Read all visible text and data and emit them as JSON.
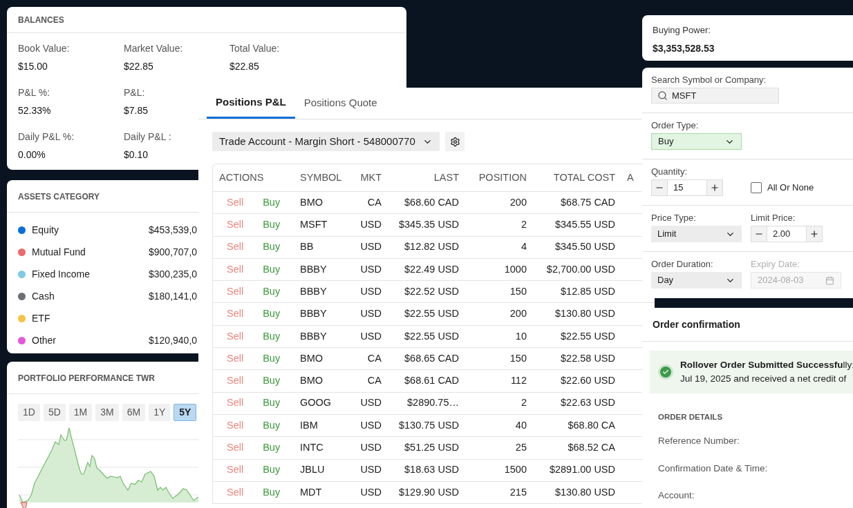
{
  "balances": {
    "title": "BALANCES",
    "rows": [
      [
        {
          "label": "Book Value:",
          "value": "$15.00"
        },
        {
          "label": "Market Value:",
          "value": "$22.85"
        },
        {
          "label": "Total Value:",
          "value": "$22.85"
        }
      ],
      [
        {
          "label": "P&L %:",
          "value": "52.33%"
        },
        {
          "label": "P&L:",
          "value": "$7.85"
        }
      ],
      [
        {
          "label": "Daily P&L %:",
          "value": "0.00%"
        },
        {
          "label": "Daily P&L :",
          "value": "$0.10"
        }
      ]
    ]
  },
  "assets": {
    "title": "ASSETS CATEGORY",
    "items": [
      {
        "label": "Equity",
        "value": "$453,539,0",
        "color": "#0b6fd8"
      },
      {
        "label": "Mutual Fund",
        "value": "$900,707,0",
        "color": "#ec6a6a"
      },
      {
        "label": "Fixed Income",
        "value": "$300,235,0",
        "color": "#7ecbe6"
      },
      {
        "label": "Cash",
        "value": "$180,141,0",
        "color": "#6b6f76"
      },
      {
        "label": "ETF",
        "color": "#f6c343"
      },
      {
        "label": "Other",
        "value": "$120,940,0",
        "color": "#e25ad6"
      }
    ]
  },
  "performance": {
    "title": "PORTFOLIO PERFORMANCE TWR",
    "periods": [
      {
        "label": "1D",
        "selected": false
      },
      {
        "label": "5D",
        "selected": false
      },
      {
        "label": "1M",
        "selected": false
      },
      {
        "label": "3M",
        "selected": false
      },
      {
        "label": "6M",
        "selected": false
      },
      {
        "label": "1Y",
        "selected": false
      },
      {
        "label": "5Y",
        "selected": true
      }
    ]
  },
  "positions": {
    "tabs": [
      {
        "label": "Positions P&L",
        "selected": true
      },
      {
        "label": "Positions Quote",
        "selected": false
      }
    ],
    "account": "Trade Account - Margin Short - 548000770",
    "columns": [
      "ACTIONS",
      "SYMBOL",
      "MKT",
      "LAST",
      "POSITION",
      "TOTAL COST",
      "A"
    ],
    "rows": [
      {
        "cells": [
          [
            "Sell",
            "Buy"
          ],
          "BMO",
          "CA",
          "$68.60 CAD",
          "200",
          "$68.75 CAD"
        ]
      },
      {
        "cells": [
          [
            "Sell",
            "Buy"
          ],
          "MSFT",
          "USD",
          "$345.35 USD",
          "2",
          "$345.55 USD"
        ]
      },
      {
        "cells": [
          [
            "Sell",
            "Buy"
          ],
          "BB",
          "USD",
          "$12.82 USD",
          "4",
          "$345.50 USD"
        ]
      },
      {
        "cells": [
          [
            "Sell",
            "Buy"
          ],
          "BBBY",
          "USD",
          "$22.49 USD",
          "1000",
          "$2,700.00 USD"
        ]
      },
      {
        "cells": [
          [
            "Sell",
            "Buy"
          ],
          "BBBY",
          "USD",
          "$22.52 USD",
          "150",
          "$12.85 USD"
        ]
      },
      {
        "cells": [
          [
            "Sell",
            "Buy"
          ],
          "BBBY",
          "USD",
          "$22.55 USD",
          "200",
          "$130.80 USD"
        ]
      },
      {
        "cells": [
          [
            "Sell",
            "Buy"
          ],
          "BBBY",
          "USD",
          "$22.55 USD",
          "10",
          "$22.55 USD"
        ]
      },
      {
        "cells": [
          [
            "Sell",
            "Buy"
          ],
          "BMO",
          "CA",
          "$68.65 CAD",
          "150",
          "$22.58 USD"
        ]
      },
      {
        "cells": [
          [
            "Sell",
            "Buy"
          ],
          "BMO",
          "CA",
          "$68.61 CAD",
          "112",
          "$22.60 USD"
        ]
      },
      {
        "cells": [
          [
            "Sell",
            "Buy"
          ],
          "GOOG",
          "USD",
          "$2890.75…",
          "2",
          "$22.63 USD"
        ]
      },
      {
        "cells": [
          [
            "Sell",
            "Buy"
          ],
          "IBM",
          "USD",
          "$130.75 USD",
          "40",
          "$68.80 CA"
        ]
      },
      {
        "cells": [
          [
            "Sell",
            "Buy"
          ],
          "INTC",
          "USD",
          "$51.25 USD",
          "25",
          "$68.52 CA"
        ]
      },
      {
        "cells": [
          [
            "Sell",
            "Buy"
          ],
          "JBLU",
          "USD",
          "$18.63 USD",
          "1500",
          "$2891.00 USD"
        ]
      },
      {
        "cells": [
          [
            "Sell",
            "Buy"
          ],
          "MDT",
          "USD",
          "$129.90 USD",
          "215",
          "$130.80 USD"
        ]
      }
    ]
  },
  "buying_power": {
    "label": "Buying Power:",
    "value": "$3,353,528.53"
  },
  "order_form": {
    "search": {
      "label": "Search Symbol or Company:",
      "value": "MSFT"
    },
    "order_type": {
      "label": "Order Type:",
      "value": "Buy"
    },
    "quantity": {
      "label": "Quantity:",
      "value": "15"
    },
    "all_or_none": {
      "label": "All Or None",
      "checked": false
    },
    "price_type": {
      "label": "Price Type:",
      "value": "Limit"
    },
    "limit_price": {
      "label": "Limit Price:",
      "value": "2.00"
    },
    "order_duration": {
      "label": "Order Duration:",
      "value": "Day"
    },
    "expiry_date": {
      "label": "Expiry Date:",
      "value": "2024-08-03",
      "disabled": true
    }
  },
  "confirmation": {
    "title": "Order confirmation",
    "message": [
      "**Rollover Order Submitted Successfu**lly:",
      "Jul 19, 2025 and received a net credit of"
    ],
    "details_title": "ORDER DETAILS",
    "details": [
      "Reference Number:",
      "Confirmation Date & Time:",
      "Account:"
    ]
  }
}
